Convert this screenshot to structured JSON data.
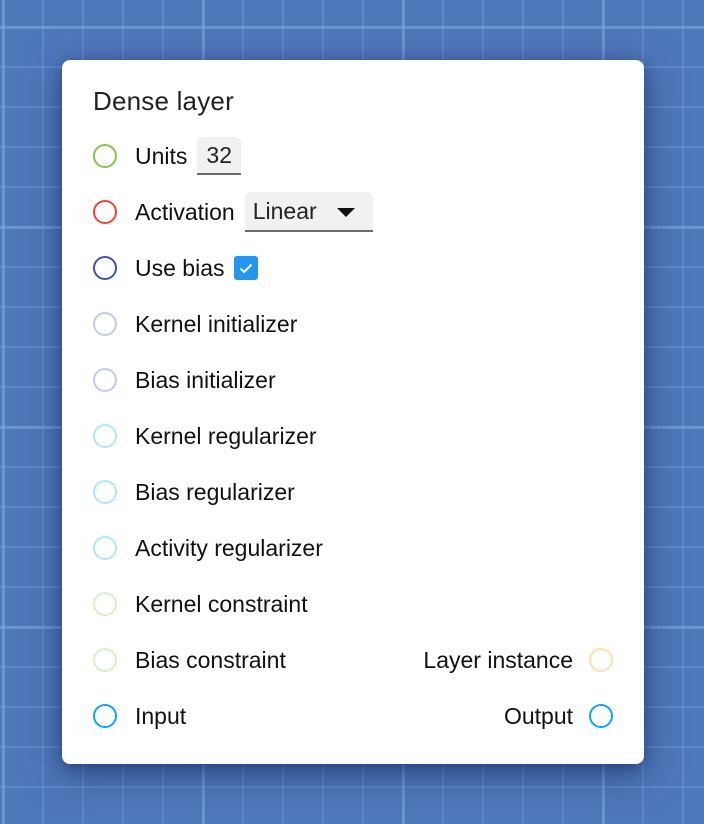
{
  "node": {
    "title": "Dense layer",
    "rows": [
      {
        "label": "Units",
        "port_color": "#8bc34a",
        "control": "number",
        "value": "32"
      },
      {
        "label": "Activation",
        "port_color": "#f44336",
        "control": "select",
        "value": "Linear"
      },
      {
        "label": "Use bias",
        "port_color": "#3f51b5",
        "control": "checkbox",
        "checked": true
      },
      {
        "label": "Kernel initializer",
        "port_color": "#c5cae9"
      },
      {
        "label": "Bias initializer",
        "port_color": "#c5cae9"
      },
      {
        "label": "Kernel regularizer",
        "port_color": "#b3e5fc"
      },
      {
        "label": "Bias regularizer",
        "port_color": "#b3e5fc"
      },
      {
        "label": "Activity regularizer",
        "port_color": "#b3e5fc"
      },
      {
        "label": "Kernel constraint",
        "port_color": "#dcedc8"
      },
      {
        "label": "Bias constraint",
        "port_color": "#dcedc8"
      },
      {
        "label": "Input",
        "port_color": "#03a9f4"
      }
    ],
    "outputs": [
      {
        "label": "Layer instance",
        "port_color": "#ffe0b2"
      },
      {
        "label": "Output",
        "port_color": "#03a9f4"
      }
    ],
    "checkbox_color": "#2196f3"
  }
}
